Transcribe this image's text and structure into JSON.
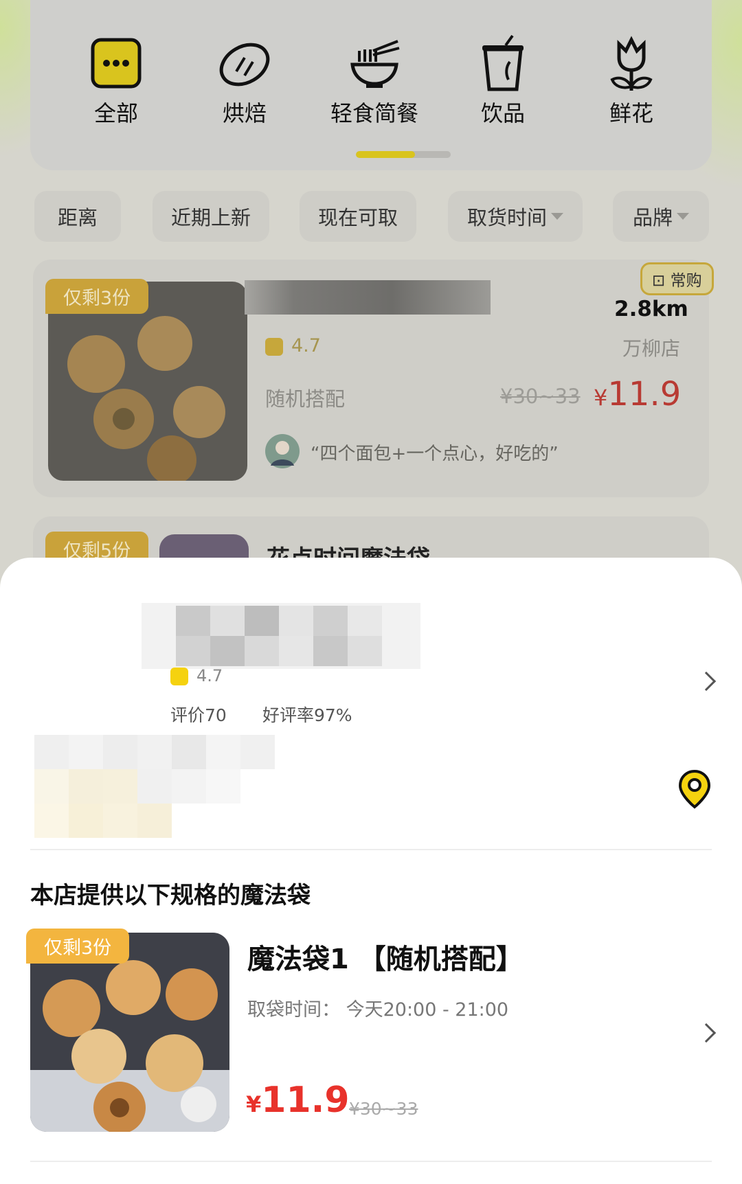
{
  "categories": [
    {
      "label": "全部",
      "icon": "more-dots-icon"
    },
    {
      "label": "烘焙",
      "icon": "bread-icon"
    },
    {
      "label": "轻食简餐",
      "icon": "noodle-bowl-icon"
    },
    {
      "label": "饮品",
      "icon": "drink-cup-icon"
    },
    {
      "label": "鲜花",
      "icon": "tulip-icon"
    }
  ],
  "filters": [
    {
      "label": "距离"
    },
    {
      "label": "近期上新"
    },
    {
      "label": "现在可取"
    },
    {
      "label": "取货时间"
    },
    {
      "label": "品牌"
    }
  ],
  "listing1": {
    "stock": "仅剩3份",
    "badge": "常购",
    "distance": "2.8km",
    "rating": "4.7",
    "branch": "万柳店",
    "bag_type": "随机搭配",
    "original_price": "¥30~33",
    "price_symbol": "¥",
    "price": "11.9",
    "review": "“四个面包+一个点心，好吃的”"
  },
  "listing2": {
    "stock": "仅剩5份",
    "title_partial": "花点时间魔法袋"
  },
  "sheet": {
    "rating": "4.7",
    "review_count": "评价70",
    "positive_rate": "好评率97%",
    "section_title": "本店提供以下规格的魔法袋",
    "bag": {
      "stock": "仅剩3份",
      "title": "魔法袋1 【随机搭配】",
      "pickup_time": "取袋时间：  今天20:00 - 21:00",
      "price_symbol": "¥",
      "price": "11.9",
      "original_price": "¥30~33"
    }
  },
  "colors": {
    "accent_yellow": "#f5d20f",
    "price_red": "#e8322b",
    "tag_orange": "#f3b53f"
  }
}
